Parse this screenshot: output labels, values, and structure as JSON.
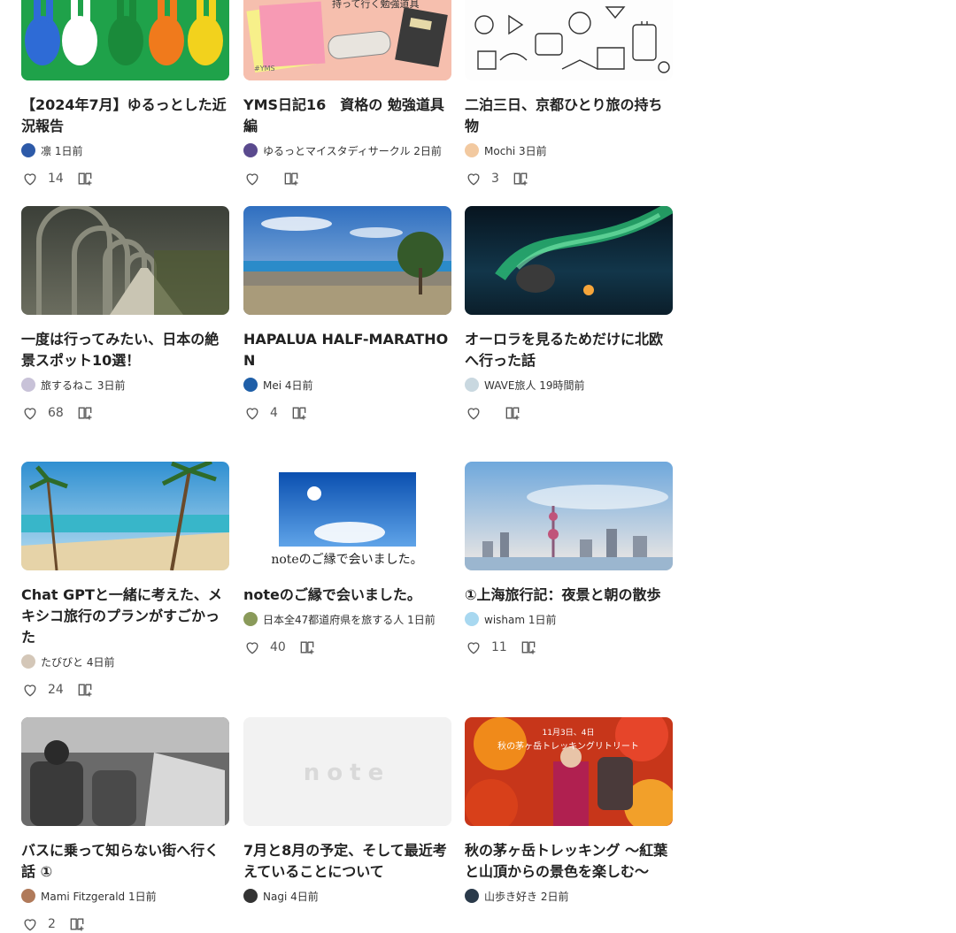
{
  "cards": [
    {
      "title": "【2024年7月】ゆるっとした近況報告",
      "author": "凛 1日前",
      "likes": "14",
      "thumb_colors": [
        "#1fa24a",
        "#2e6bd6",
        "#f07a1c",
        "#f2d21d"
      ]
    },
    {
      "title": "YMS日記16　資格の 勉強道具編",
      "author": "ゆるっとマイスタディサークル 2日前",
      "likes": "",
      "thumb_colors": [
        "#f6b9a6",
        "#f7d6c8"
      ]
    },
    {
      "title": "二泊三日、京都ひとり旅の持ち物",
      "author": "Mochi 3日前",
      "likes": "3",
      "thumb_colors": [
        "#ffffff",
        "#eeeeee"
      ]
    },
    {
      "title": "一度は行ってみたい、日本の絶景スポット10選！",
      "author": "旅するねこ 3日前",
      "likes": "68",
      "thumb_colors": [
        "#4b4f45",
        "#8a8f7d"
      ]
    },
    {
      "title": "HAPALUA HALF-MARATHON",
      "author": "Mei 4日前",
      "likes": "4",
      "thumb_colors": [
        "#3f7fc9",
        "#8fb7dd"
      ]
    },
    {
      "title": "オーロラを見るためだけに北欧へ行った話",
      "author": "WAVE旅人 19時間前",
      "likes": "",
      "thumb_colors": [
        "#0a1d2b",
        "#2fd17d"
      ]
    },
    {
      "title": "Chat GPTと一緒に考えた、メキシコ旅行のプランがすごかった",
      "author": "たびびと 4日前",
      "likes": "24",
      "thumb_colors": [
        "#2f8fd1",
        "#e6d3a8"
      ]
    },
    {
      "title": "noteのご縁で会いました。",
      "author": "日本全47都道府県を旅する人 1日前",
      "likes": "40",
      "thumb_colors": [
        "#1a6fd0",
        "#ffffff"
      ]
    },
    {
      "title": "①上海旅行記：夜景と朝の散歩",
      "author": "wisham 1日前",
      "likes": "11",
      "thumb_colors": [
        "#bcd6ef",
        "#e9eef5"
      ]
    },
    {
      "title": "バスに乗って知らない街へ行く話 ①",
      "author": "Mami Fitzgerald 1日前",
      "likes": "2",
      "thumb_colors": [
        "#555555",
        "#bbbbbb"
      ]
    },
    {
      "title": "7月と8月の予定、そして最近考えていることについて",
      "author": "Nagi 4日前",
      "likes": "",
      "thumb_colors": [
        "#f2f2f2",
        "#e0e0e0"
      ]
    },
    {
      "title": "秋の茅ヶ岳トレッキング ～紅葉と山頂からの景色を楽しむ～",
      "author": "山歩き好き 2日前",
      "likes": "",
      "thumb_colors": [
        "#d8401a",
        "#f2a02a"
      ]
    }
  ],
  "thumb_texts": {
    "yms_header": "持って行く勉強道具",
    "yms_tag": "#YMS",
    "note_caption": "noteのご縁で会いました。",
    "note_logo": "note",
    "trek_date": "11月3日、4日",
    "trek_title": "秋の茅ヶ岳トレッキングリトリート"
  },
  "icons": {
    "like": "heart-icon",
    "save": "magazine-add-icon"
  },
  "colors": {
    "text": "#222222",
    "meta": "#555555"
  }
}
